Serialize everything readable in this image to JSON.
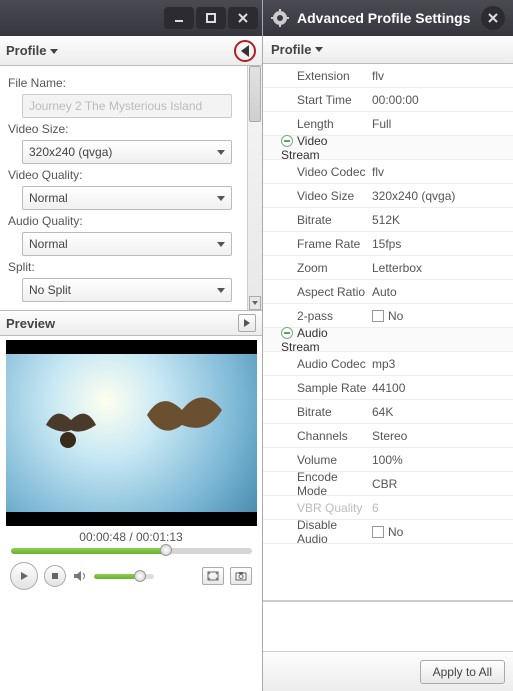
{
  "left": {
    "profile_label": "Profile",
    "file_name_label": "File Name:",
    "file_name_value": "Journey 2 The Mysterious Island",
    "video_size_label": "Video Size:",
    "video_size_value": "320x240 (qvga)",
    "video_quality_label": "Video Quality:",
    "video_quality_value": "Normal",
    "audio_quality_label": "Audio Quality:",
    "audio_quality_value": "Normal",
    "split_label": "Split:",
    "split_value": "No Split",
    "preview_label": "Preview",
    "timecode": "00:00:48 / 00:01:13"
  },
  "right": {
    "title": "Advanced Profile Settings",
    "profile_label": "Profile",
    "rows": [
      {
        "section": false,
        "key": "Extension",
        "val": "flv"
      },
      {
        "section": false,
        "key": "Start Time",
        "val": "00:00:00"
      },
      {
        "section": false,
        "key": "Length",
        "val": "Full"
      },
      {
        "section": true,
        "key": "Video Stream",
        "val": ""
      },
      {
        "section": false,
        "key": "Video Codec",
        "val": "flv"
      },
      {
        "section": false,
        "key": "Video Size",
        "val": "320x240 (qvga)"
      },
      {
        "section": false,
        "key": "Bitrate",
        "val": "512K"
      },
      {
        "section": false,
        "key": "Frame Rate",
        "val": "15fps"
      },
      {
        "section": false,
        "key": "Zoom",
        "val": "Letterbox"
      },
      {
        "section": false,
        "key": "Aspect Ratio",
        "val": "Auto"
      },
      {
        "section": false,
        "key": "2-pass",
        "val": "No",
        "checkbox": true
      },
      {
        "section": true,
        "key": "Audio Stream",
        "val": ""
      },
      {
        "section": false,
        "key": "Audio Codec",
        "val": "mp3"
      },
      {
        "section": false,
        "key": "Sample Rate",
        "val": "44100"
      },
      {
        "section": false,
        "key": "Bitrate",
        "val": "64K"
      },
      {
        "section": false,
        "key": "Channels",
        "val": "Stereo"
      },
      {
        "section": false,
        "key": "Volume",
        "val": "100%"
      },
      {
        "section": false,
        "key": "Encode Mode",
        "val": "CBR"
      },
      {
        "section": false,
        "key": "VBR Quality",
        "val": "6",
        "disabled": true
      },
      {
        "section": false,
        "key": "Disable Audio",
        "val": "No",
        "checkbox": true
      }
    ],
    "apply_label": "Apply to All"
  }
}
